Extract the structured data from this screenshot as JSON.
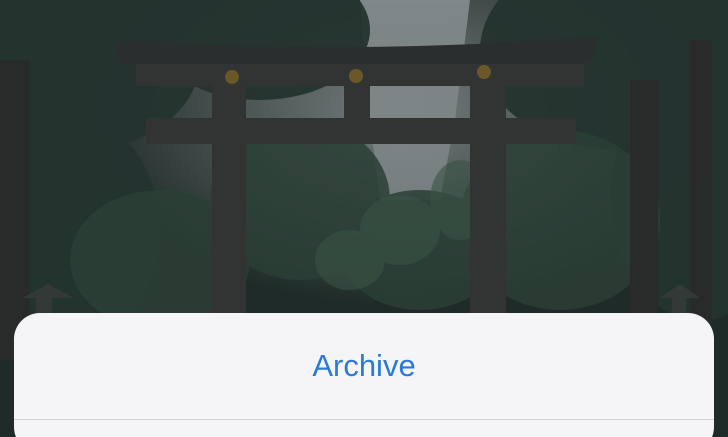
{
  "background": {
    "description_icon": "torii-gate-photo"
  },
  "action_sheet": {
    "items": [
      {
        "label": "Archive",
        "color": "#2a7bd4"
      }
    ]
  }
}
